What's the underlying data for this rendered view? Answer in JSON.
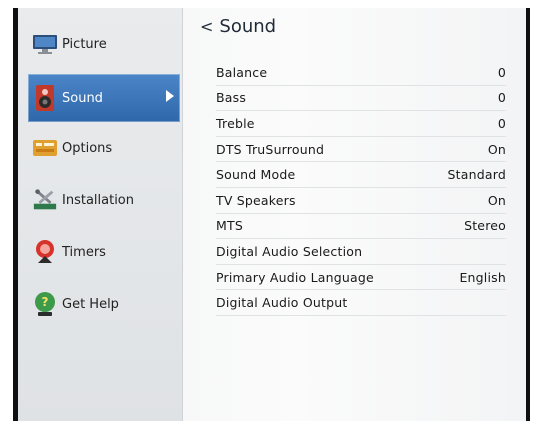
{
  "page_title": "Sound",
  "sidebar": {
    "items": [
      {
        "label": "Picture",
        "icon": "monitor-icon"
      },
      {
        "label": "Sound",
        "icon": "speaker-icon",
        "active": true
      },
      {
        "label": "Options",
        "icon": "options-icon"
      },
      {
        "label": "Installation",
        "icon": "tools-icon"
      },
      {
        "label": "Timers",
        "icon": "timer-icon"
      },
      {
        "label": "Get Help",
        "icon": "help-icon"
      }
    ]
  },
  "settings": [
    {
      "label": "Balance",
      "value": "0"
    },
    {
      "label": "Bass",
      "value": "0"
    },
    {
      "label": "Treble",
      "value": "0"
    },
    {
      "label": "DTS TruSurround",
      "value": "On"
    },
    {
      "label": "Sound Mode",
      "value": "Standard"
    },
    {
      "label": "TV Speakers",
      "value": "On"
    },
    {
      "label": "MTS",
      "value": "Stereo"
    },
    {
      "label": "Digital Audio Selection",
      "value": ""
    },
    {
      "label": "Primary Audio Language",
      "value": "English"
    },
    {
      "label": "Digital Audio Output",
      "value": ""
    }
  ],
  "colors": {
    "accent": "#2f67ab",
    "background": "#f3f4f5",
    "bezel": "#101010"
  }
}
